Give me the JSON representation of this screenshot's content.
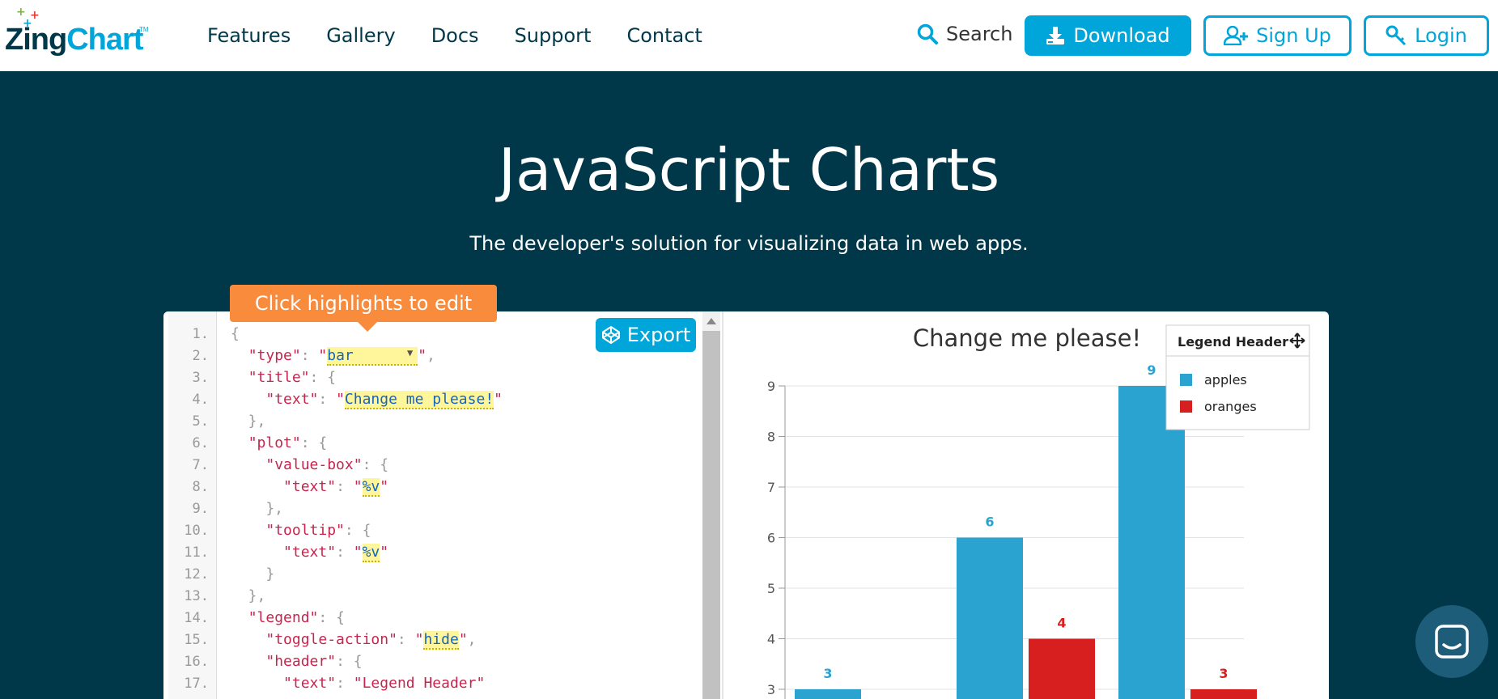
{
  "brand": {
    "name_part1": "Zing",
    "name_part2": "Chart",
    "tm": "TM"
  },
  "nav": {
    "items": [
      "Features",
      "Gallery",
      "Docs",
      "Support",
      "Contact"
    ]
  },
  "header": {
    "search_label": "Search",
    "download_label": "Download",
    "signup_label": "Sign Up",
    "login_label": "Login"
  },
  "hero": {
    "title": "JavaScript Charts",
    "subtitle": "The developer's solution for visualizing data in web apps."
  },
  "editor": {
    "tooltip": "Click highlights to edit",
    "export_label": "Export",
    "line_numbers": [
      "1.",
      "2.",
      "3.",
      "4.",
      "5.",
      "6.",
      "7.",
      "8.",
      "9.",
      "10.",
      "11.",
      "12.",
      "13.",
      "14.",
      "15.",
      "16.",
      "17."
    ],
    "type_value": "bar",
    "title_text": "Change me please!",
    "value_box_text": "%v",
    "tooltip_text": "%v",
    "toggle_action": "hide",
    "legend_header_text": "Legend Header"
  },
  "colors": {
    "accent": "#00a5d9",
    "dark": "#003849",
    "apples": "#2aa3d1",
    "oranges": "#d71f1f",
    "tip": "#f98b3c"
  },
  "chart_data": {
    "type": "bar",
    "title": "Change me please!",
    "categories": [
      "",
      "",
      ""
    ],
    "series": [
      {
        "name": "apples",
        "values": [
          3,
          6,
          9
        ],
        "color": "#2aa3d1"
      },
      {
        "name": "oranges",
        "values": [
          null,
          4,
          3
        ],
        "color": "#d71f1f"
      }
    ],
    "y_ticks": [
      3,
      4,
      5,
      6,
      7,
      8,
      9
    ],
    "legend": {
      "header": "Legend Header",
      "placement": "top-right"
    },
    "grid": true
  }
}
